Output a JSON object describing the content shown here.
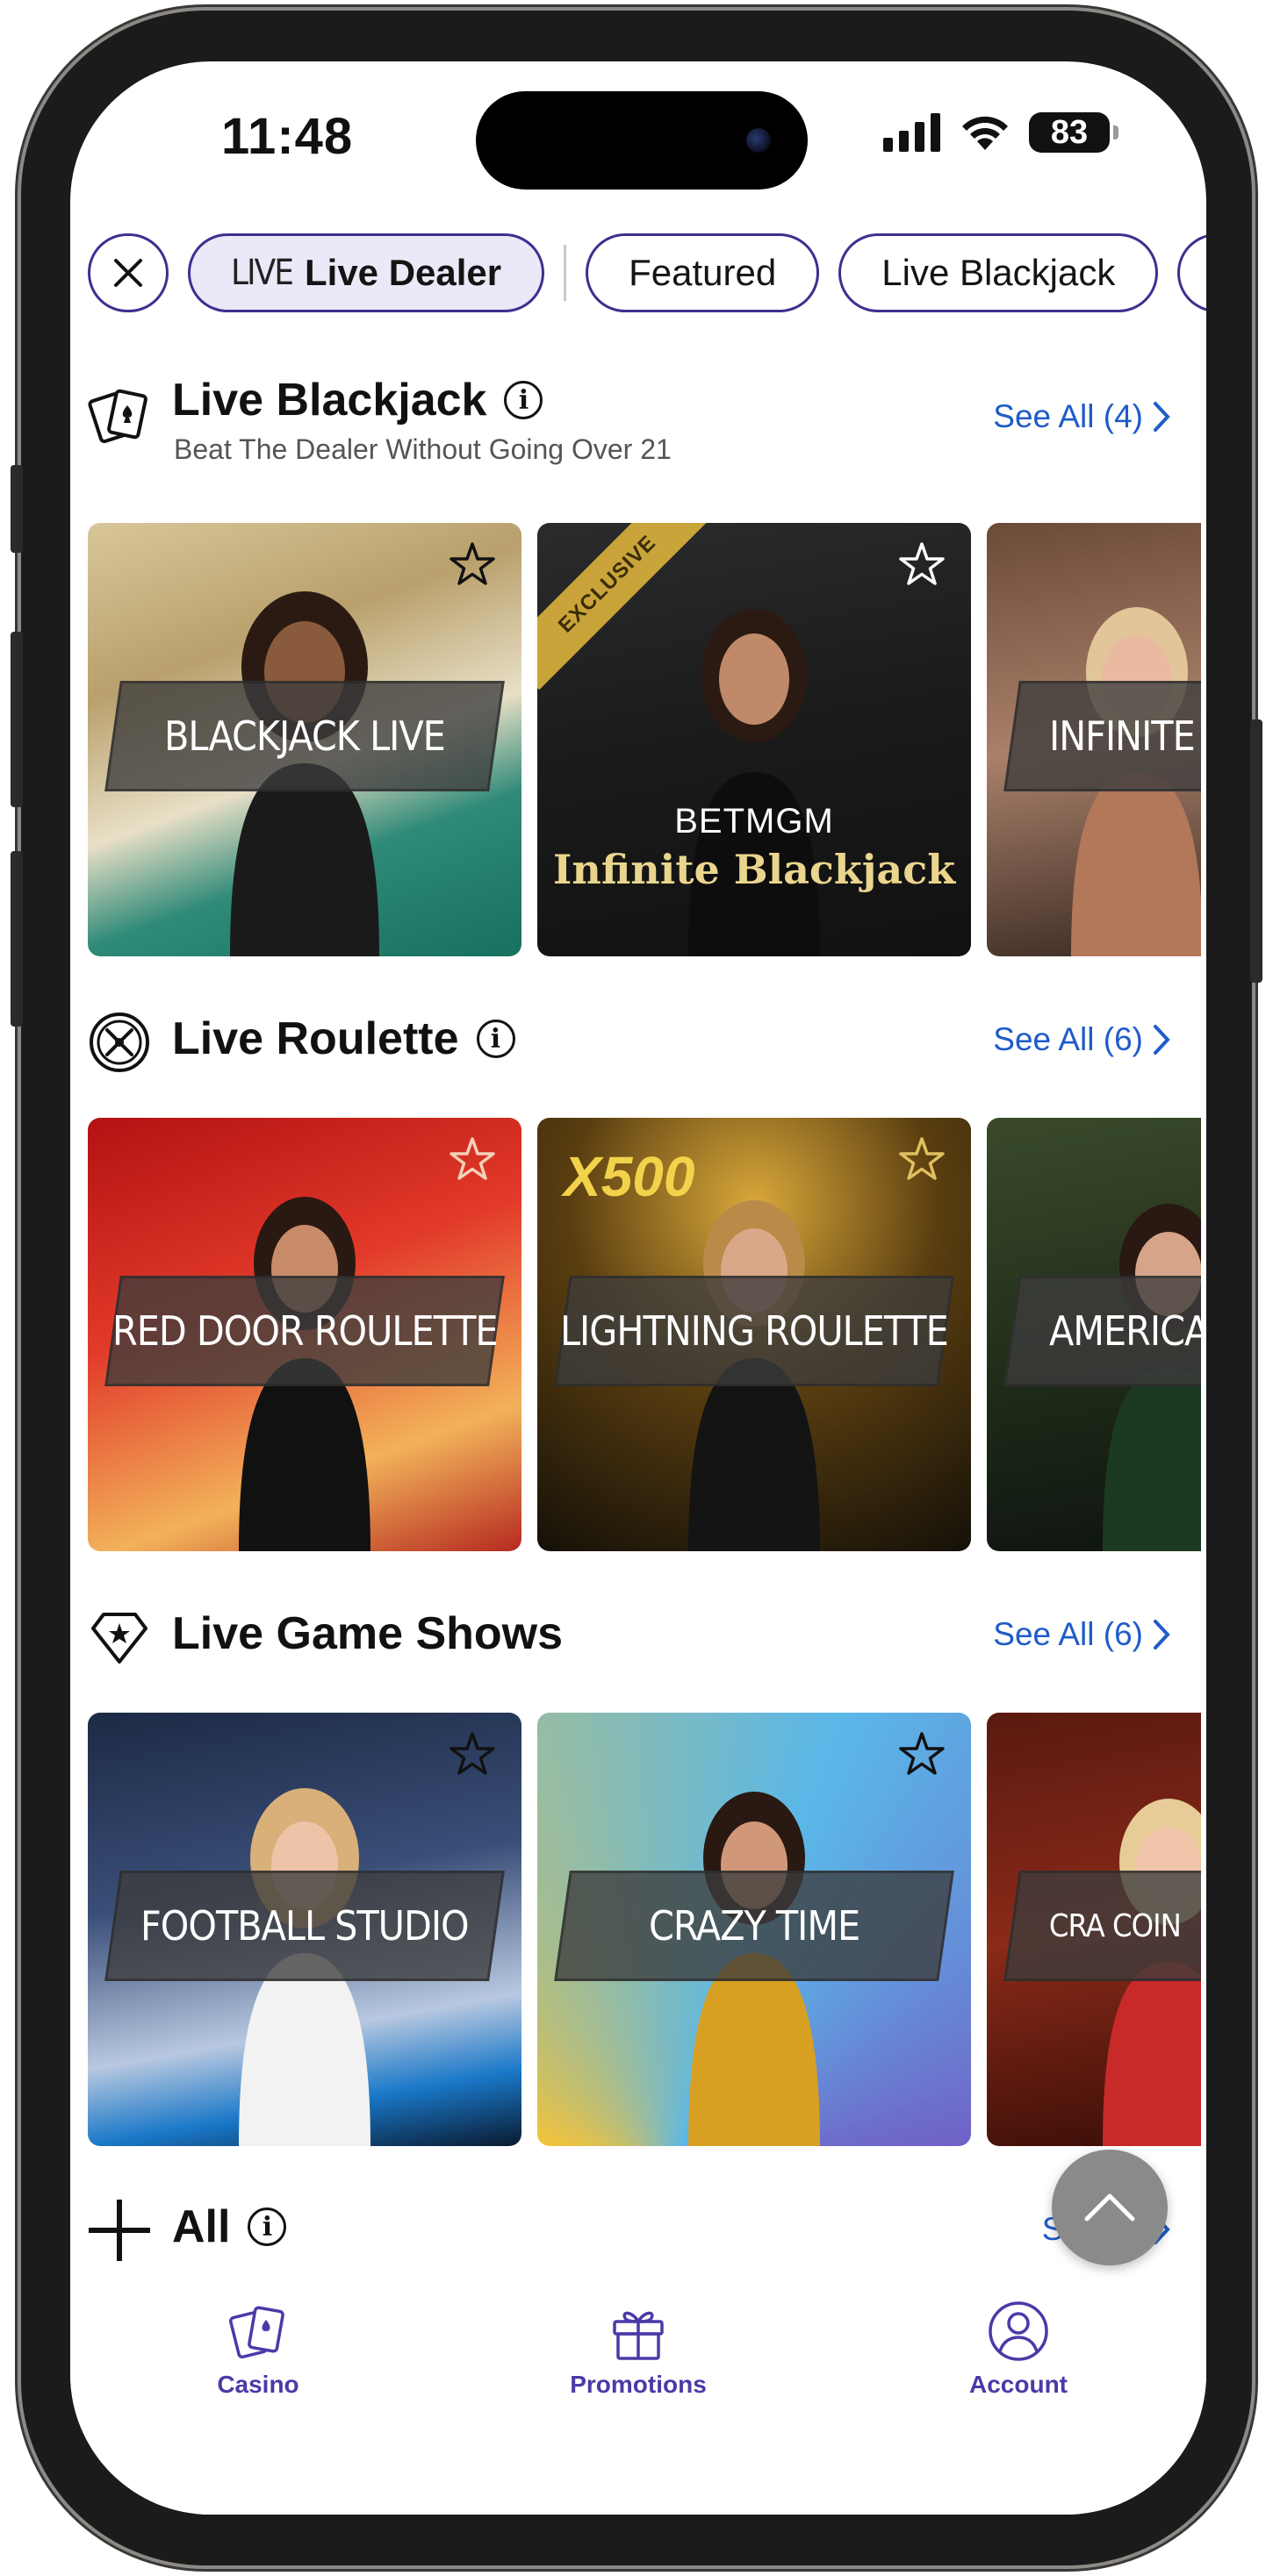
{
  "status_bar": {
    "time": "11:48",
    "battery": "83"
  },
  "filters": {
    "chips": [
      {
        "tag": "LIVE",
        "label": "Live Dealer",
        "active": true
      },
      {
        "label": "Featured"
      },
      {
        "label": "Live Blackjack"
      }
    ]
  },
  "sections": {
    "blackjack": {
      "title": "Live Blackjack",
      "subtitle": "Beat The Dealer Without Going Over 21",
      "see_all": "See All (4)",
      "games": [
        "BLACKJACK LIVE",
        "Infinite Blackjack",
        "INFINITE B"
      ],
      "exclusive_tag": "EXCLUSIVE",
      "brand": "BETMGM"
    },
    "roulette": {
      "title": "Live Roulette",
      "see_all": "See All (6)",
      "games": [
        "RED DOOR ROULETTE",
        "LIGHTNING ROULETTE",
        "AMERICAN"
      ]
    },
    "game_shows": {
      "title": "Live Game Shows",
      "see_all": "See All (6)",
      "games": [
        "FOOTBALL STUDIO",
        "CRAZY TIME",
        "CRA COIN"
      ]
    },
    "all": {
      "title": "All",
      "see_all": "See All"
    }
  },
  "bottom_nav": {
    "items": [
      {
        "label": "Casino",
        "icon": "cards-icon"
      },
      {
        "label": "Promotions",
        "icon": "gift-icon"
      },
      {
        "label": "Account",
        "icon": "user-icon"
      }
    ]
  },
  "colors": {
    "accent": "#3e2f8f",
    "link": "#1f5cc9",
    "nav": "#4a3aa7"
  }
}
